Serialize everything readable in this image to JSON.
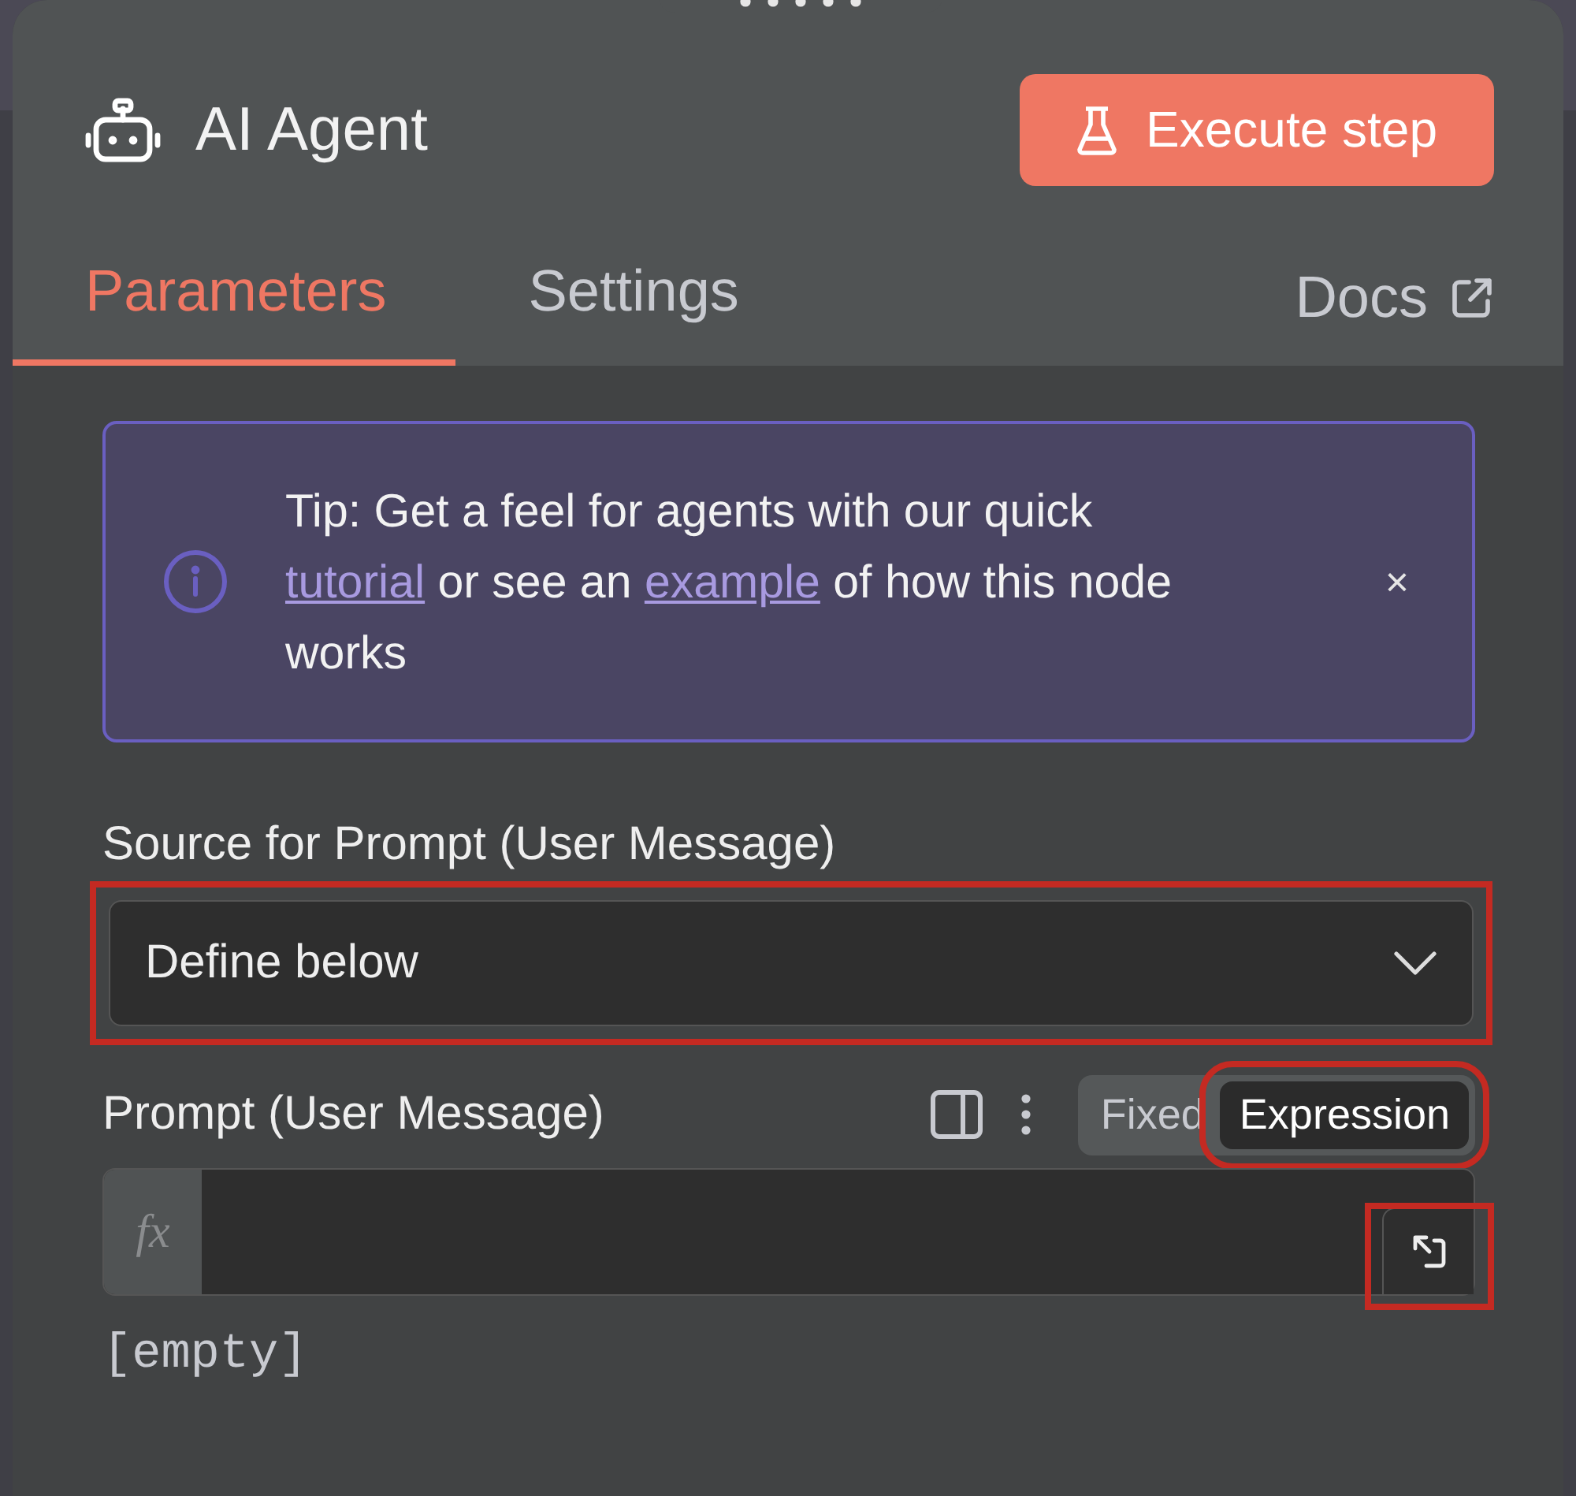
{
  "panel": {
    "title": "AI Agent",
    "execute_button": "Execute step"
  },
  "tabs": [
    {
      "label": "Parameters",
      "selected": true
    },
    {
      "label": "Settings",
      "selected": false
    }
  ],
  "docs_link": "Docs",
  "tip": {
    "text_before": "Tip: Get a feel for agents with our quick",
    "link_1": "tutorial",
    "text_middle": "or see an",
    "link_2": "example",
    "text_after": "of how this node works",
    "close": "×"
  },
  "source_field": {
    "label": "Source for Prompt (User Message)",
    "value": "Define below",
    "highlighted": true
  },
  "prompt_field": {
    "label": "Prompt (User Message)",
    "modes": [
      {
        "label": "Fixed",
        "selected": false,
        "highlighted": false
      },
      {
        "label": "Expression",
        "selected": true,
        "highlighted": true
      }
    ],
    "prefix": "fx",
    "expand_highlighted": true,
    "preview": "[empty]"
  }
}
